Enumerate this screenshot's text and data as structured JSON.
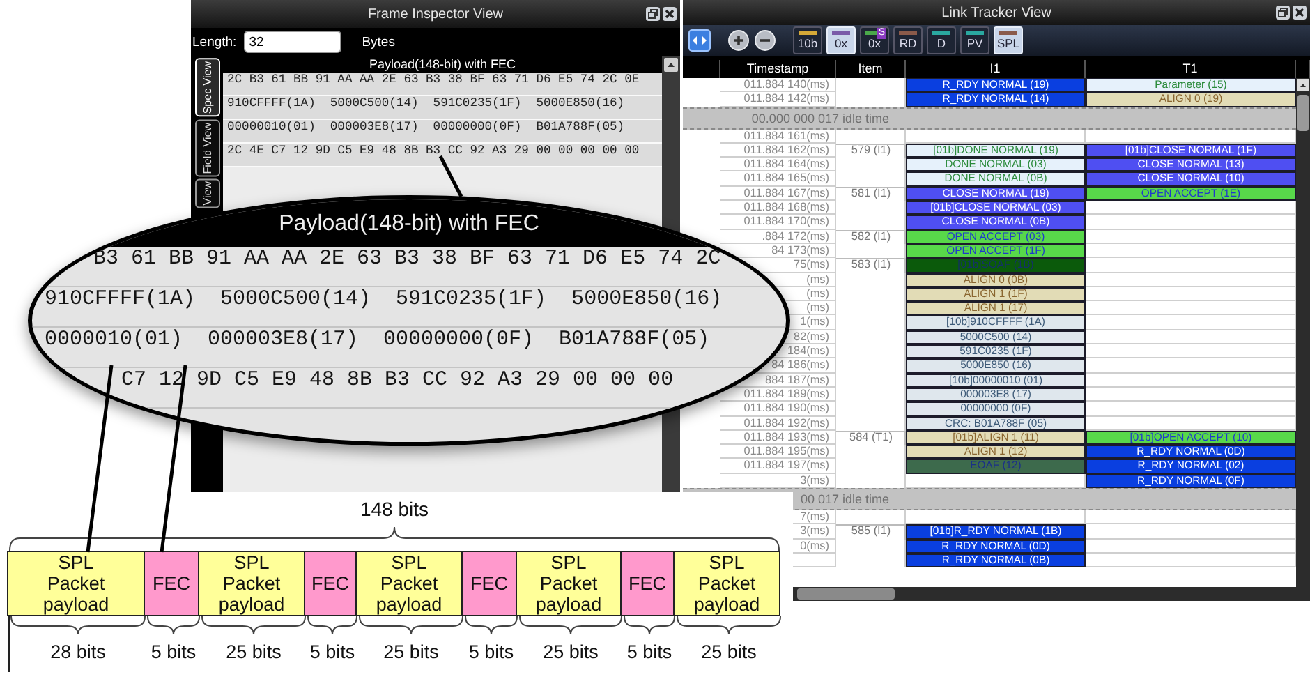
{
  "frame_inspector": {
    "title": "Frame Inspector View",
    "length_label": "Length:",
    "length_value": "32",
    "length_unit": "Bytes",
    "tabs": [
      {
        "label": "Spec View",
        "selected": true
      },
      {
        "label": "Field View",
        "selected": false
      },
      {
        "label": "View",
        "selected": false
      }
    ],
    "payload_header": "Payload(148-bit) with FEC",
    "payload_rows": [
      "2C B3 61 BB 91 AA AA 2E 63 B3 38 BF 63 71 D6 E5 74 2C 0E",
      "910CFFFF(1A)  5000C500(14)  591C0235(1F)  5000E850(16)",
      "00000010(01)  000003E8(17)  00000000(0F)  B01A788F(05)",
      "2C 4E C7 12 9D C5 E9 48 8B B3 CC 92 A3 29 00 00 00 00 00"
    ]
  },
  "link_tracker": {
    "title": "Link Tracker View",
    "toolbar": [
      {
        "label": "10b",
        "on": false,
        "color": "#d4a838"
      },
      {
        "label": "0x",
        "on": true,
        "color": "#7a5aa8"
      },
      {
        "label": "0x",
        "badge": "S",
        "on": false,
        "color": "#4aa84a"
      },
      {
        "label": "RD",
        "on": false,
        "color": "#8a5a4a"
      },
      {
        "label": "D",
        "on": false,
        "color": "#2aa8a0"
      },
      {
        "label": "PV",
        "on": false,
        "color": "#2aa8a0"
      },
      {
        "label": "SPL",
        "on": true,
        "color": "#8a5a4a"
      }
    ],
    "columns": [
      "Timestamp",
      "Item",
      "I1",
      "T1"
    ],
    "rows": [
      {
        "kind": "event",
        "timestamp": "011.884 140(ms)",
        "i1": {
          "text": "R_RDY NORMAL (19)",
          "kind": "rrdy"
        },
        "t1": {
          "text": "Parameter (15)",
          "kind": "param"
        }
      },
      {
        "kind": "event",
        "timestamp": "011.884 142(ms)",
        "i1": {
          "text": "R_RDY NORMAL (14)",
          "kind": "rrdy"
        },
        "t1": {
          "text": "ALIGN 0 (19)",
          "kind": "align"
        }
      },
      {
        "kind": "idle",
        "text": "00.000 000 017 idle time"
      },
      {
        "kind": "event",
        "timestamp": "011.884 161(ms)"
      },
      {
        "kind": "event",
        "timestamp": "011.884 162(ms)",
        "item": "579 (I1)",
        "i1": {
          "text": "[01b]DONE NORMAL (19)",
          "kind": "done"
        },
        "t1": {
          "text": "[01b]CLOSE NORMAL (1F)",
          "kind": "close"
        }
      },
      {
        "kind": "event",
        "timestamp": "011.884 164(ms)",
        "i1": {
          "text": "DONE NORMAL (03)",
          "kind": "done"
        },
        "t1": {
          "text": "CLOSE NORMAL (13)",
          "kind": "close"
        }
      },
      {
        "kind": "event",
        "timestamp": "011.884 165(ms)",
        "i1": {
          "text": "DONE NORMAL (0B)",
          "kind": "done"
        },
        "t1": {
          "text": "CLOSE NORMAL (10)",
          "kind": "close"
        }
      },
      {
        "kind": "event",
        "timestamp": "011.884 167(ms)",
        "item": "581 (I1)",
        "i1": {
          "text": "CLOSE NORMAL (19)",
          "kind": "close"
        },
        "t1": {
          "text": "OPEN ACCEPT (1E)",
          "kind": "open"
        }
      },
      {
        "kind": "event",
        "timestamp": "011.884 168(ms)",
        "i1": {
          "text": "[01b]CLOSE NORMAL (03)",
          "kind": "close"
        }
      },
      {
        "kind": "event",
        "timestamp": "011.884 170(ms)",
        "i1": {
          "text": "CLOSE NORMAL (0B)",
          "kind": "close"
        }
      },
      {
        "kind": "event",
        "timestamp": ".884 172(ms)",
        "item": "582 (I1)",
        "i1": {
          "text": "OPEN ACCEPT (03)",
          "kind": "open"
        }
      },
      {
        "kind": "event",
        "timestamp": "84 173(ms)",
        "i1": {
          "text": "OPEN ACCEPT (1F)",
          "kind": "open"
        }
      },
      {
        "kind": "event",
        "timestamp": "75(ms)",
        "item": "583 (I1)",
        "i1": {
          "text": "[01b]SOAF (1B)",
          "kind": "soaf"
        }
      },
      {
        "kind": "event",
        "timestamp": "(ms)",
        "i1": {
          "text": "ALIGN 0 (0B)",
          "kind": "align"
        }
      },
      {
        "kind": "event",
        "timestamp": "(ms)",
        "i1": {
          "text": "ALIGN 1 (1F)",
          "kind": "align"
        }
      },
      {
        "kind": "event",
        "timestamp": "(ms)",
        "i1": {
          "text": "ALIGN 1 (17)",
          "kind": "align"
        }
      },
      {
        "kind": "event",
        "timestamp": "1(ms)",
        "i1": {
          "text": "[10b]910CFFFF (1A)",
          "kind": "data"
        }
      },
      {
        "kind": "event",
        "timestamp": "82(ms)",
        "i1": {
          "text": "5000C500 (14)",
          "kind": "data"
        }
      },
      {
        "kind": "event",
        "timestamp": "184(ms)",
        "i1": {
          "text": "591C0235 (1F)",
          "kind": "data"
        }
      },
      {
        "kind": "event",
        "timestamp": "84 186(ms)",
        "i1": {
          "text": "5000E850 (16)",
          "kind": "data"
        }
      },
      {
        "kind": "event",
        "timestamp": "884 187(ms)",
        "i1": {
          "text": "[10b]00000010 (01)",
          "kind": "data"
        }
      },
      {
        "kind": "event",
        "timestamp": "011.884 189(ms)",
        "i1": {
          "text": "000003E8 (17)",
          "kind": "data"
        }
      },
      {
        "kind": "event",
        "timestamp": "011.884 190(ms)",
        "i1": {
          "text": "00000000 (0F)",
          "kind": "data"
        }
      },
      {
        "kind": "event",
        "timestamp": "011.884 192(ms)",
        "i1": {
          "text": "CRC: B01A788F (05)",
          "kind": "data"
        }
      },
      {
        "kind": "event",
        "timestamp": "011.884 193(ms)",
        "item": "584 (T1)",
        "i1": {
          "text": "[01b]ALIGN 1 (11)",
          "kind": "align"
        },
        "t1": {
          "text": "[01b]OPEN ACCEPT (10)",
          "kind": "open"
        }
      },
      {
        "kind": "event",
        "timestamp": "011.884 195(ms)",
        "i1": {
          "text": "ALIGN 1 (12)",
          "kind": "align"
        },
        "t1": {
          "text": "R_RDY NORMAL (0D)",
          "kind": "rrdy"
        }
      },
      {
        "kind": "event",
        "timestamp": "011.884 197(ms)",
        "i1": {
          "text": "EOAF (12)",
          "kind": "eoaf"
        },
        "t1": {
          "text": "R_RDY NORMAL (02)",
          "kind": "rrdy"
        }
      },
      {
        "kind": "event",
        "timestamp": "3(ms)",
        "t1": {
          "text": "R_RDY NORMAL (0F)",
          "kind": "rrdy"
        }
      },
      {
        "kind": "idle",
        "text": "00 017 idle time"
      },
      {
        "kind": "event",
        "timestamp": "7(ms)"
      },
      {
        "kind": "event",
        "timestamp": "3(ms)",
        "item": "585 (I1)",
        "i1": {
          "text": "[01b]R_RDY NORMAL (1B)",
          "kind": "rrdy"
        }
      },
      {
        "kind": "event",
        "timestamp": "0(ms)",
        "i1": {
          "text": "R_RDY NORMAL (0D)",
          "kind": "rrdy"
        }
      },
      {
        "kind": "event",
        "i1": {
          "text": "R_RDY NORMAL (0B)",
          "kind": "rrdy"
        }
      }
    ]
  },
  "magnifier": {
    "header": "Payload(148-bit) with FEC",
    "rows": [
      "B3 61 BB 91 AA AA 2E 63 B3 38 BF 63 71 D6 E5 74 2C",
      "910CFFFF(1A)  5000C500(14)  591C0235(1F)  5000E850(16)",
      "0000010(01)  000003E8(17)  00000000(0F)  B01A788F(05)",
      "C7 12 9D C5 E9 48 8B B3 CC 92 A3 29 00 00 00"
    ]
  },
  "diagram": {
    "total": "148 bits",
    "segments": [
      {
        "kind": "payload",
        "label": "SPL Packet payload",
        "bits": "28 bits"
      },
      {
        "kind": "fec",
        "label": "FEC",
        "bits": "5 bits"
      },
      {
        "kind": "payload",
        "label": "SPL Packet payload",
        "bits": "25 bits"
      },
      {
        "kind": "fec",
        "label": "FEC",
        "bits": "5 bits"
      },
      {
        "kind": "payload",
        "label": "SPL Packet payload",
        "bits": "25 bits"
      },
      {
        "kind": "fec",
        "label": "FEC",
        "bits": "5 bits"
      },
      {
        "kind": "payload",
        "label": "SPL Packet payload",
        "bits": "25 bits"
      },
      {
        "kind": "fec",
        "label": "FEC",
        "bits": "5 bits"
      },
      {
        "kind": "payload",
        "label": "SPL Packet payload",
        "bits": "25 bits"
      }
    ]
  }
}
